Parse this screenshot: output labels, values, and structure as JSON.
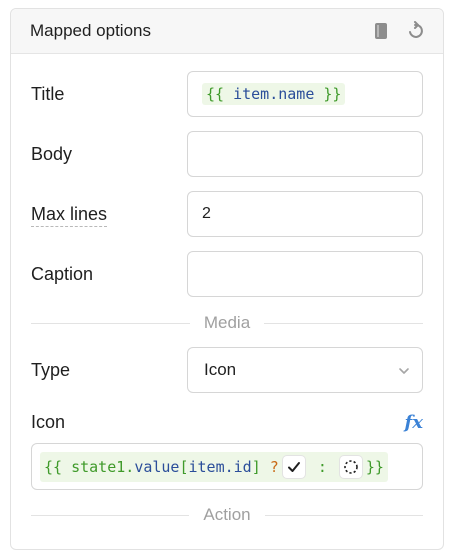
{
  "panel": {
    "title": "Mapped options",
    "header_icons": [
      "book-icon",
      "undo-icon"
    ]
  },
  "fields": {
    "title": {
      "label": "Title",
      "value_open": "{{ ",
      "value_var": "item.name",
      "value_close": " }}"
    },
    "body": {
      "label": "Body",
      "value": ""
    },
    "max_lines": {
      "label": "Max lines",
      "value": "2"
    },
    "caption": {
      "label": "Caption",
      "value": ""
    }
  },
  "sections": {
    "media": "Media",
    "action": "Action"
  },
  "type": {
    "label": "Type",
    "selected": "Icon",
    "dropdown_icon": "chevron-down-icon"
  },
  "icon": {
    "label": "Icon",
    "fx_label": "fx",
    "expr": {
      "open": "{{ ",
      "state": "state1",
      "dot": ".",
      "value": "value",
      "lbr": "[",
      "item": "item.id",
      "rbr": "] ",
      "q": "?",
      "colon": " : ",
      "close": "}}",
      "true_icon": "check-icon",
      "false_icon": "dashed-circle-icon"
    }
  },
  "colors": {
    "code_green": "#3f9a2a",
    "code_blue": "#2b4e9a",
    "code_orange": "#c96a17",
    "fx_blue": "#3b82d6"
  }
}
